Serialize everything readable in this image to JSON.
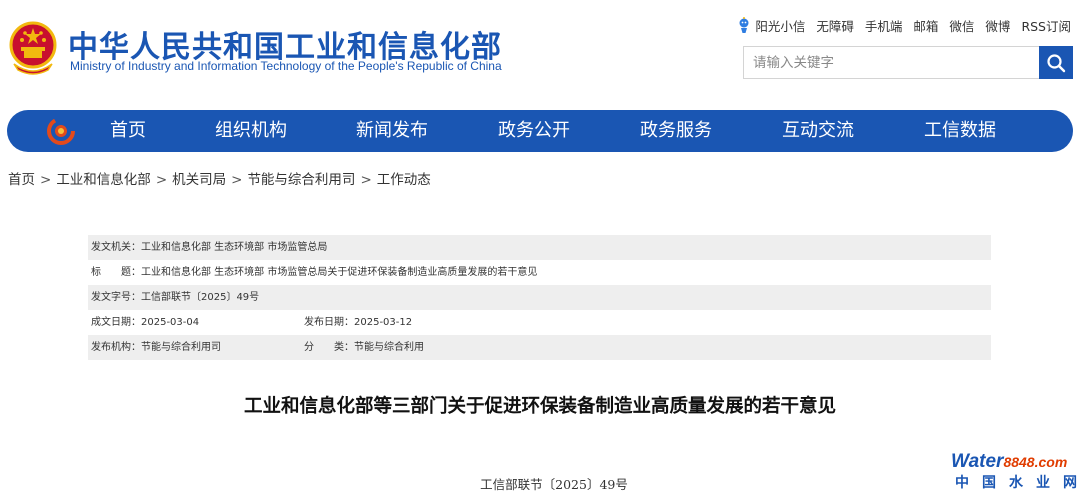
{
  "header": {
    "title": "中华人民共和国工业和信息化部",
    "subtitle": "Ministry of Industry and Information Technology of the People's Republic of China",
    "emblem_icon": "national-emblem-icon",
    "top_links": [
      "阳光小信",
      "无障碍",
      "手机端",
      "邮箱",
      "微信",
      "微博",
      "RSS订阅"
    ],
    "search": {
      "placeholder": "请输入关键字",
      "icon": "search-icon"
    }
  },
  "nav": {
    "logo_icon": "miit-logo-icon",
    "items": [
      "首页",
      "组织机构",
      "新闻发布",
      "政务公开",
      "政务服务",
      "互动交流",
      "工信数据"
    ]
  },
  "breadcrumb": [
    "首页",
    "工业和信息化部",
    "机关司局",
    "节能与综合利用司",
    "工作动态"
  ],
  "breadcrumb_sep": ">",
  "info": {
    "issuer_label": "发文机关：",
    "issuer": "工业和信息化部 生态环境部 市场监管总局",
    "title_label": "标　　题：",
    "title": "工业和信息化部 生态环境部 市场监管总局关于促进环保装备制造业高质量发展的若干意见",
    "docno_label": "发文字号：",
    "docno": "工信部联节〔2025〕49号",
    "created_label": "成文日期：",
    "created": "2025-03-04",
    "published_label": "发布日期：",
    "published": "2025-03-12",
    "org_label": "发布机构：",
    "org": "节能与综合利用司",
    "category_label": "分　　类：",
    "category": "节能与综合利用"
  },
  "article": {
    "title": "工业和信息化部等三部门关于促进环保装备制造业高质量发展的若干意见",
    "doc_number": "工信部联节〔2025〕49号"
  },
  "watermark": {
    "brand": "Water",
    "brand_num": "8848.com",
    "cn": "中国水业网"
  },
  "colors": {
    "primary": "#1a56b3",
    "shade": "#eeeeee",
    "accent": "#e03c00"
  }
}
